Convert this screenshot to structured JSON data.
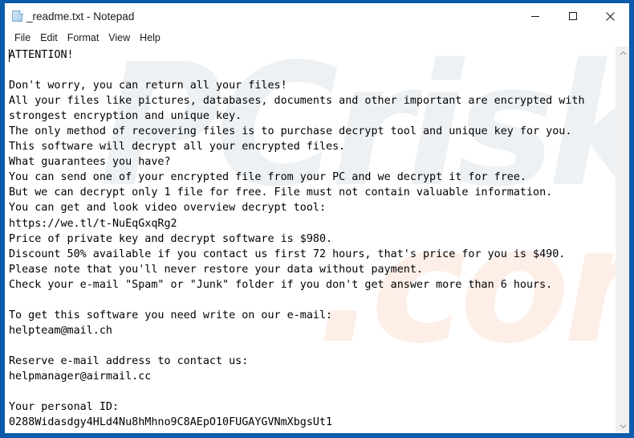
{
  "window": {
    "title": "_readme.txt - Notepad",
    "icon": "notepad-document-icon",
    "frame_color": "#0a5bab",
    "background_color": "#ffffff",
    "controls": {
      "minimize": "minimize-icon",
      "maximize": "maximize-icon",
      "close": "close-icon"
    }
  },
  "menu": {
    "items": [
      {
        "label": "File"
      },
      {
        "label": "Edit"
      },
      {
        "label": "Format"
      },
      {
        "label": "View"
      },
      {
        "label": "Help"
      }
    ]
  },
  "editor": {
    "text_color": "#000000",
    "watermark_primary": "PCrisk",
    "watermark_secondary": ".com",
    "lines": [
      "ATTENTION!",
      "",
      "Don't worry, you can return all your files!",
      "All your files like pictures, databases, documents and other important are encrypted with",
      "strongest encryption and unique key.",
      "The only method of recovering files is to purchase decrypt tool and unique key for you.",
      "This software will decrypt all your encrypted files.",
      "What guarantees you have?",
      "You can send one of your encrypted file from your PC and we decrypt it for free.",
      "But we can decrypt only 1 file for free. File must not contain valuable information.",
      "You can get and look video overview decrypt tool:",
      "https://we.tl/t-NuEqGxqRg2",
      "Price of private key and decrypt software is $980.",
      "Discount 50% available if you contact us first 72 hours, that's price for you is $490.",
      "Please note that you'll never restore your data without payment.",
      "Check your e-mail \"Spam\" or \"Junk\" folder if you don't get answer more than 6 hours.",
      "",
      "To get this software you need write on our e-mail:",
      "helpteam@mail.ch",
      "",
      "Reserve e-mail address to contact us:",
      "helpmanager@airmail.cc",
      "",
      "Your personal ID:",
      "0288Widasdgy4HLd4Nu8hMhno9C8AEpO10FUGAYGVNmXbgsUt1"
    ],
    "ransom_details": {
      "price_full": "$980",
      "price_discounted": "$490",
      "discount_percent": "50%",
      "discount_window": "72 hours",
      "response_time": "6 hours",
      "free_file_count": "1",
      "video_url": "https://we.tl/t-NuEqGxqRg2",
      "primary_email": "helpteam@mail.ch",
      "reserve_email": "helpmanager@airmail.cc",
      "personal_id": "0288Widasdgy4HLd4Nu8hMhno9C8AEpO10FUGAYGVNmXbgsUt1"
    }
  },
  "scrollbar": {
    "up_arrow": "chevron-up-icon",
    "down_arrow": "chevron-down-icon",
    "orientation": "vertical"
  }
}
